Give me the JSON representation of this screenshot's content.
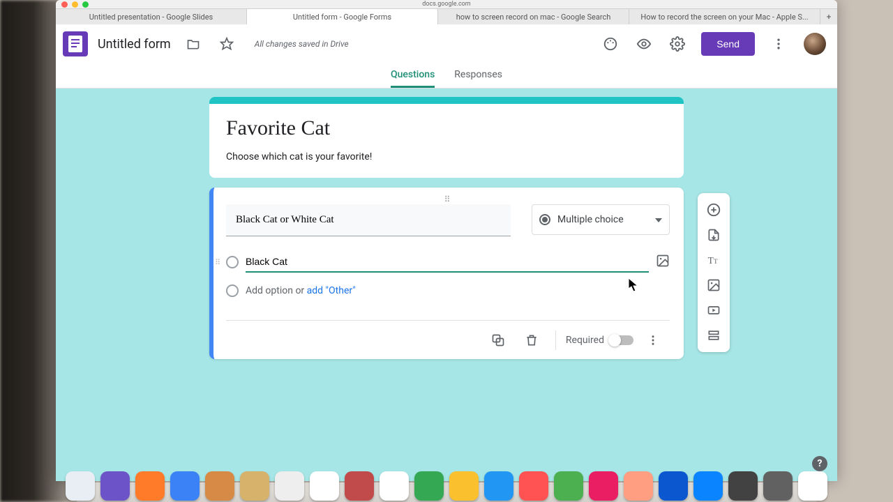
{
  "browser": {
    "address_hint": "docs.google.com",
    "tabs": [
      "Untitled presentation - Google Slides",
      "Untitled form - Google Forms",
      "how to screen record on mac - Google Search",
      "How to record the screen on your Mac - Apple S..."
    ],
    "active_tab_index": 1
  },
  "header": {
    "form_title": "Untitled form",
    "save_status": "All changes saved in Drive",
    "send_label": "Send"
  },
  "subtabs": {
    "questions": "Questions",
    "responses": "Responses",
    "active": "questions"
  },
  "form": {
    "title": "Favorite Cat",
    "description": "Choose which cat is your favorite!"
  },
  "question": {
    "title": "Black Cat or White Cat",
    "type_label": "Multiple choice",
    "options": [
      {
        "label": "Black Cat",
        "editing": true
      }
    ],
    "add_option_text": "Add option",
    "or_text": "or",
    "add_other_text": "add \"Other\"",
    "required_label": "Required",
    "required_on": false
  },
  "dock_colors": [
    "#e8eef4",
    "#6c53c8",
    "#ff7a29",
    "#3b82f6",
    "#d68a45",
    "#d6b26a",
    "#eeeeee",
    "#ffffff",
    "#c14b4b",
    "#ffffff",
    "#35a853",
    "#fbc02d",
    "#2196f3",
    "#ff5252",
    "#4caf50",
    "#e91e63",
    "#ff9e80",
    "#0b57d0",
    "#0a84ff",
    "#424242",
    "#616161",
    "#ffffff"
  ]
}
